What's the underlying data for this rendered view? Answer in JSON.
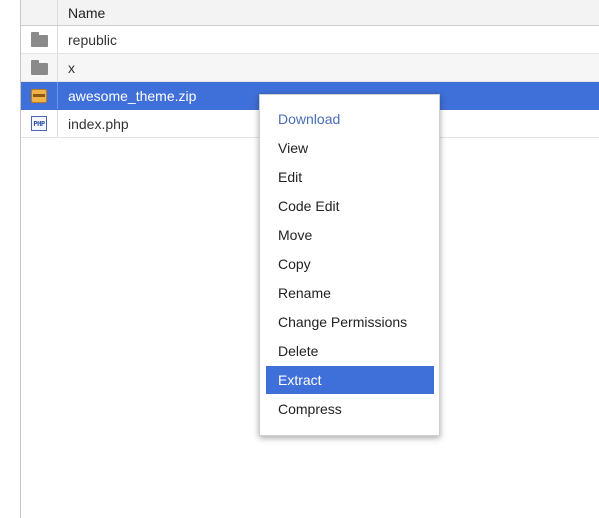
{
  "table": {
    "column_name": "Name",
    "rows": [
      {
        "name": "republic",
        "type": "folder",
        "icon": "folder-icon"
      },
      {
        "name": "x",
        "type": "folder",
        "icon": "folder-icon"
      },
      {
        "name": "awesome_theme.zip",
        "type": "zip",
        "icon": "archive-icon",
        "selected": true
      },
      {
        "name": "index.php",
        "type": "php",
        "icon": "php-file-icon"
      }
    ]
  },
  "context_menu": {
    "items": [
      "Download",
      "View",
      "Edit",
      "Code Edit",
      "Move",
      "Copy",
      "Rename",
      "Change Permissions",
      "Delete",
      "Extract",
      "Compress"
    ],
    "highlighted": "Extract"
  },
  "icons": {
    "php_label": "PHP"
  },
  "colors": {
    "selection": "#3f6fd8",
    "menu_link": "#4a6db8"
  }
}
